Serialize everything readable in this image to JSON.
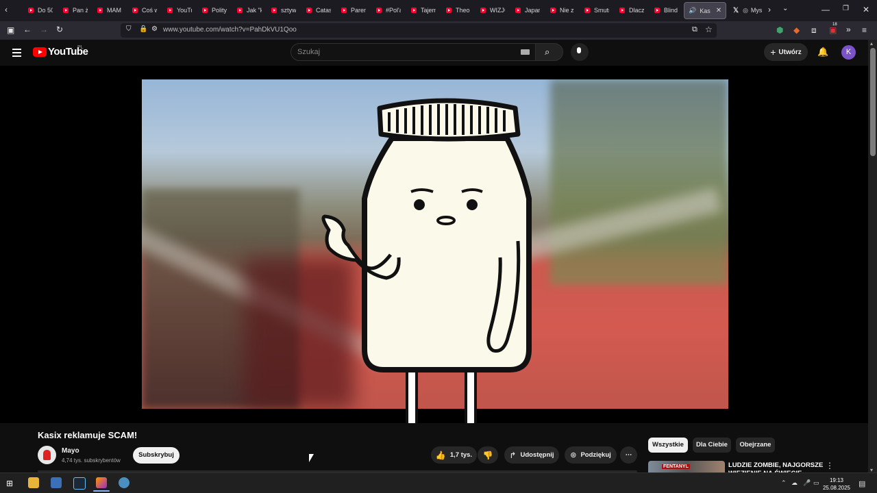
{
  "browser": {
    "tabs": [
      {
        "label": "Do 50"
      },
      {
        "label": "Pan ż"
      },
      {
        "label": "MAM"
      },
      {
        "label": "Coś w"
      },
      {
        "label": "YouTu"
      },
      {
        "label": "Polity"
      },
      {
        "label": "Jak \"k"
      },
      {
        "label": "sztyw"
      },
      {
        "label": "Catas"
      },
      {
        "label": "Paren"
      },
      {
        "label": "#Pol'a"
      },
      {
        "label": "Tajem"
      },
      {
        "label": "Theo"
      },
      {
        "label": "WIZJC"
      },
      {
        "label": "Japan"
      },
      {
        "label": "Nie z"
      },
      {
        "label": "Smutr"
      },
      {
        "label": "Dlacz"
      },
      {
        "label": "Blind"
      }
    ],
    "active_tab": {
      "label": "Kas"
    },
    "x_tab": {
      "label": "Mys"
    },
    "url": "www.youtube.com/watch?v=PahDkVU1Qoo",
    "ext_badge": "18"
  },
  "youtube": {
    "logo_text": "YouTube",
    "region": "PL",
    "search_placeholder": "Szukaj",
    "create_label": "Utwórz",
    "avatar_letter": "K"
  },
  "video": {
    "title": "Kasix reklamuje SCAM!",
    "channel": "Mayo",
    "subscribers": "4,74 tys. subskrybentów",
    "subscribe_label": "Subskrybuj",
    "likes": "1,7 tys.",
    "share_label": "Udostępnij",
    "thanks_label": "Podziękuj"
  },
  "sidebar": {
    "chips": [
      "Wszystkie",
      "Dla Ciebie",
      "Obejrzane"
    ],
    "recommendation": {
      "title": "LUDZIE ZOMBIE, NAJGORSZE WIĘZIENIE NA ŚWIECIE",
      "thumb_text": "FENTANYL"
    }
  },
  "taskbar": {
    "time": "19:13",
    "date": "25.08.2025"
  },
  "colors": {
    "youtube_red": "#ff0000",
    "page_bg": "#0f0f0f",
    "avatar": "#7b52c7"
  }
}
